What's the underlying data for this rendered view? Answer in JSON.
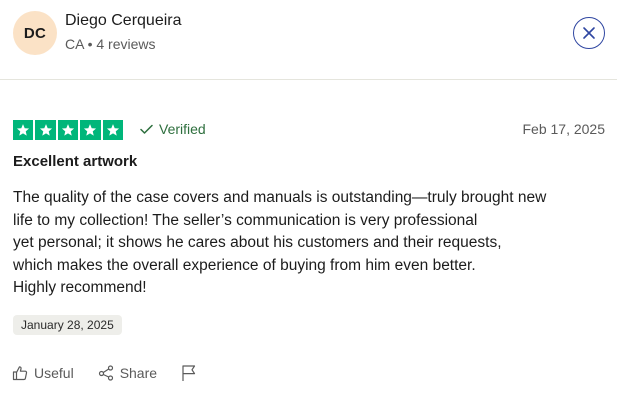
{
  "reviewer": {
    "initials": "DC",
    "name": "Diego Cerqueira",
    "meta": "CA • 4 reviews",
    "avatar_color": "#fbe2c6"
  },
  "review": {
    "rating": 5,
    "star_color": "#00b67a",
    "verified_label": "Verified",
    "date": "Feb 17, 2025",
    "title": "Excellent artwork",
    "body_lines": [
      "The quality of the case covers and manuals is outstanding—truly brought new",
      "life to my collection! The seller’s communication is very professional",
      "yet personal; it shows he cares about his customers and their requests,",
      "which makes the overall experience of buying from him even better.",
      "Highly recommend!"
    ],
    "experience_date": "January 28, 2025"
  },
  "actions": {
    "useful_label": "Useful",
    "share_label": "Share"
  },
  "icons": {
    "close": "close-icon",
    "check": "checkmark-icon",
    "thumbs_up": "thumbs-up-icon",
    "share": "share-icon",
    "flag": "flag-icon",
    "star": "star-icon"
  }
}
